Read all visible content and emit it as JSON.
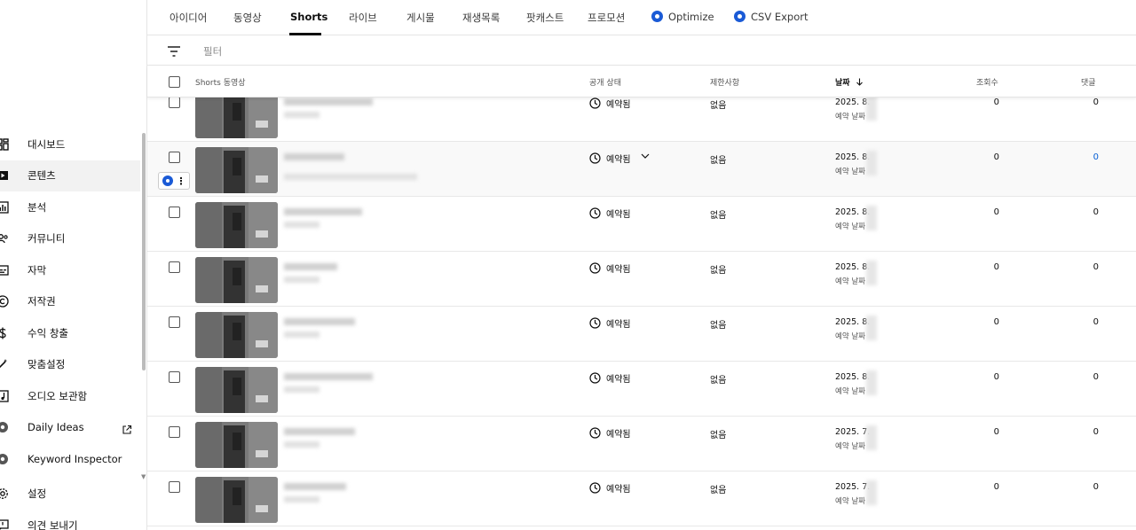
{
  "tabs": [
    {
      "label": "아이디어"
    },
    {
      "label": "동영상"
    },
    {
      "label": "Shorts"
    },
    {
      "label": "라이브"
    },
    {
      "label": "게시물"
    },
    {
      "label": "재생목록"
    },
    {
      "label": "팟캐스트"
    },
    {
      "label": "프로모션"
    },
    {
      "label": "Optimize",
      "icon": "extension-logo-icon"
    },
    {
      "label": "CSV Export",
      "icon": "extension-logo-icon"
    }
  ],
  "active_tab": "Shorts",
  "filter": {
    "placeholder": "필터"
  },
  "table_header": {
    "video": "Shorts 동영상",
    "visibility": "공개 상태",
    "restrictions": "제한사항",
    "date": "날짜",
    "views": "조회수",
    "comments": "댓글"
  },
  "rows": [
    {
      "status": "예약됨",
      "restriction": "없음",
      "date": "2025. 8.",
      "date_sub": "예약 날짜",
      "views": "0",
      "comments": "0"
    },
    {
      "status": "예약됨",
      "restriction": "없음",
      "date": "2025. 8.",
      "date_sub": "예약 날짜",
      "views": "0",
      "comments": "0"
    },
    {
      "status": "예약됨",
      "restriction": "없음",
      "date": "2025. 8.",
      "date_sub": "예약 날짜",
      "views": "0",
      "comments": "0"
    },
    {
      "status": "예약됨",
      "restriction": "없음",
      "date": "2025. 8.",
      "date_sub": "예약 날짜",
      "views": "0",
      "comments": "0"
    },
    {
      "status": "예약됨",
      "restriction": "없음",
      "date": "2025. 8.",
      "date_sub": "예약 날짜",
      "views": "0",
      "comments": "0"
    },
    {
      "status": "예약됨",
      "restriction": "없음",
      "date": "2025. 8.",
      "date_sub": "예약 날짜",
      "views": "0",
      "comments": "0"
    },
    {
      "status": "예약됨",
      "restriction": "없음",
      "date": "2025. 7.",
      "date_sub": "예약 날짜",
      "views": "0",
      "comments": "0"
    },
    {
      "status": "예약됨",
      "restriction": "없음",
      "date": "2025. 7.",
      "date_sub": "예약 날짜",
      "views": "0",
      "comments": "0"
    }
  ],
  "sidebar": {
    "items": [
      {
        "label": "대시보드",
        "icon": "dashboard-icon"
      },
      {
        "label": "콘텐츠",
        "icon": "content-icon",
        "active": true
      },
      {
        "label": "분석",
        "icon": "analytics-icon"
      },
      {
        "label": "커뮤니티",
        "icon": "community-icon"
      },
      {
        "label": "자막",
        "icon": "subtitles-icon"
      },
      {
        "label": "저작권",
        "icon": "copyright-icon"
      },
      {
        "label": "수익 창출",
        "icon": "monetization-icon"
      },
      {
        "label": "맞춤설정",
        "icon": "customization-icon"
      },
      {
        "label": "오디오 보관함",
        "icon": "audio-library-icon"
      },
      {
        "label": "Daily Ideas",
        "icon": "extension-logo-icon",
        "external": true
      },
      {
        "label": "Keyword Inspector",
        "icon": "extension-logo-icon"
      },
      {
        "label": "설정",
        "icon": "settings-icon"
      },
      {
        "label": "의견 보내기",
        "icon": "feedback-icon"
      }
    ]
  },
  "colors": {
    "accent_blue": "#065fd4",
    "extension_blue": "#1a5ad6",
    "active_bg": "#f2f2f2"
  }
}
